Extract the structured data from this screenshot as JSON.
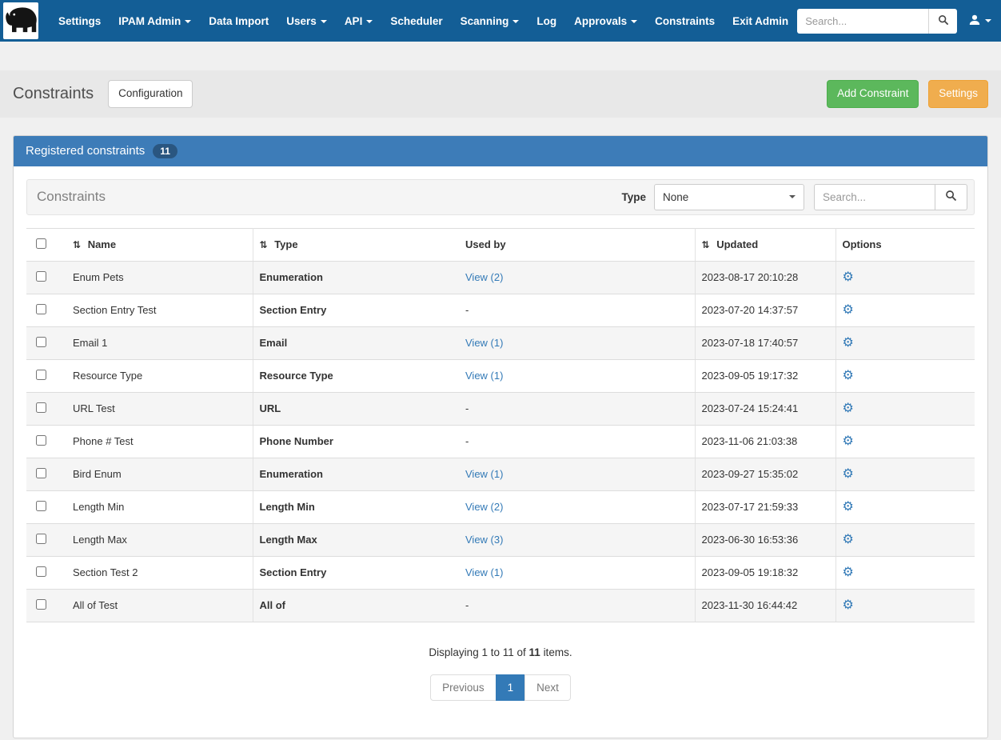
{
  "navbar": {
    "items": [
      {
        "label": "Settings",
        "dropdown": false
      },
      {
        "label": "IPAM Admin",
        "dropdown": true
      },
      {
        "label": "Data Import",
        "dropdown": false
      },
      {
        "label": "Users",
        "dropdown": true
      },
      {
        "label": "API",
        "dropdown": true
      },
      {
        "label": "Scheduler",
        "dropdown": false
      },
      {
        "label": "Scanning",
        "dropdown": true
      },
      {
        "label": "Log",
        "dropdown": false
      },
      {
        "label": "Approvals",
        "dropdown": true
      },
      {
        "label": "Constraints",
        "dropdown": false
      },
      {
        "label": "Exit Admin",
        "dropdown": false
      }
    ],
    "search": {
      "placeholder": "Search..."
    }
  },
  "page_header": {
    "title": "Constraints",
    "configuration_button": "Configuration",
    "add_constraint_button": "Add Constraint",
    "settings_button": "Settings"
  },
  "panel": {
    "title": "Registered constraints",
    "count_badge": "11",
    "toolbar": {
      "title": "Constraints",
      "type_label": "Type",
      "type_selected": "None",
      "search_placeholder": "Search..."
    },
    "table": {
      "headers": {
        "name": "Name",
        "type": "Type",
        "used_by": "Used by",
        "updated": "Updated",
        "options": "Options"
      },
      "rows": [
        {
          "name": "Enum Pets",
          "type": "Enumeration",
          "used_by": "View (2)",
          "updated": "2023-08-17 20:10:28"
        },
        {
          "name": "Section Entry Test",
          "type": "Section Entry",
          "used_by": "-",
          "updated": "2023-07-20 14:37:57"
        },
        {
          "name": "Email 1",
          "type": "Email",
          "used_by": "View (1)",
          "updated": "2023-07-18 17:40:57"
        },
        {
          "name": "Resource Type",
          "type": "Resource Type",
          "used_by": "View (1)",
          "updated": "2023-09-05 19:17:32"
        },
        {
          "name": "URL Test",
          "type": "URL",
          "used_by": "-",
          "updated": "2023-07-24 15:24:41"
        },
        {
          "name": "Phone # Test",
          "type": "Phone Number",
          "used_by": "-",
          "updated": "2023-11-06 21:03:38"
        },
        {
          "name": "Bird Enum",
          "type": "Enumeration",
          "used_by": "View (1)",
          "updated": "2023-09-27 15:35:02"
        },
        {
          "name": "Length Min",
          "type": "Length Min",
          "used_by": "View (2)",
          "updated": "2023-07-17 21:59:33"
        },
        {
          "name": "Length Max",
          "type": "Length Max",
          "used_by": "View (3)",
          "updated": "2023-06-30 16:53:36"
        },
        {
          "name": "Section Test 2",
          "type": "Section Entry",
          "used_by": "View (1)",
          "updated": "2023-09-05 19:18:32"
        },
        {
          "name": "All of Test",
          "type": "All of",
          "used_by": "-",
          "updated": "2023-11-30 16:44:42"
        }
      ]
    },
    "summary": {
      "prefix": "Displaying 1 to 11 of",
      "total": "11",
      "suffix": "items."
    },
    "pagination": {
      "previous_label": "Previous",
      "current_page": "1",
      "next_label": "Next"
    }
  },
  "colors": {
    "navbar_bg": "#135e96",
    "panel_header_bg": "#3d7cb8",
    "link": "#337ab7",
    "add_button_bg": "#5cb85c",
    "settings_button_bg": "#f0ad4e"
  }
}
